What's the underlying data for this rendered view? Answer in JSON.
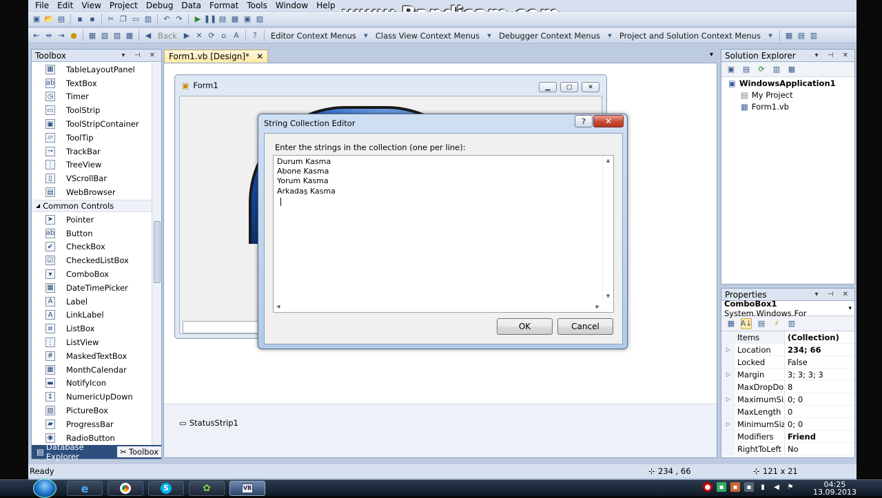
{
  "menubar": {
    "items": [
      "File",
      "Edit",
      "View",
      "Project",
      "Debug",
      "Data",
      "Format",
      "Tools",
      "Window",
      "Help"
    ]
  },
  "watermark": "www.Bandicam.com",
  "toolbar2": {
    "back_label": "Back",
    "menus": [
      "Editor Context Menus",
      "Class View Context Menus",
      "Debugger Context Menus",
      "Project and Solution Context Menus"
    ]
  },
  "toolbox": {
    "title": "Toolbox",
    "items_top": [
      {
        "label": "TableLayoutPanel",
        "icon": "table-layout-icon",
        "glyph": "▦"
      },
      {
        "label": "TextBox",
        "icon": "textbox-icon",
        "glyph": "ab"
      },
      {
        "label": "Timer",
        "icon": "timer-icon",
        "glyph": "◷"
      },
      {
        "label": "ToolStrip",
        "icon": "toolstrip-icon",
        "glyph": "▭"
      },
      {
        "label": "ToolStripContainer",
        "icon": "toolstrip-container-icon",
        "glyph": "▣"
      },
      {
        "label": "ToolTip",
        "icon": "tooltip-icon",
        "glyph": "▱"
      },
      {
        "label": "TrackBar",
        "icon": "trackbar-icon",
        "glyph": "⊸"
      },
      {
        "label": "TreeView",
        "icon": "treeview-icon",
        "glyph": "⋮"
      },
      {
        "label": "VScrollBar",
        "icon": "vscrollbar-icon",
        "glyph": "▯"
      },
      {
        "label": "WebBrowser",
        "icon": "webbrowser-icon",
        "glyph": "▤"
      }
    ],
    "category": "Common Controls",
    "items_common": [
      {
        "label": "Pointer",
        "icon": "pointer-icon",
        "glyph": "➤"
      },
      {
        "label": "Button",
        "icon": "button-icon",
        "glyph": "ab"
      },
      {
        "label": "CheckBox",
        "icon": "checkbox-icon",
        "glyph": "✔"
      },
      {
        "label": "CheckedListBox",
        "icon": "checkedlistbox-icon",
        "glyph": "☑"
      },
      {
        "label": "ComboBox",
        "icon": "combobox-icon",
        "glyph": "▾"
      },
      {
        "label": "DateTimePicker",
        "icon": "datetimepicker-icon",
        "glyph": "▦"
      },
      {
        "label": "Label",
        "icon": "label-icon",
        "glyph": "A"
      },
      {
        "label": "LinkLabel",
        "icon": "linklabel-icon",
        "glyph": "A"
      },
      {
        "label": "ListBox",
        "icon": "listbox-icon",
        "glyph": "≡"
      },
      {
        "label": "ListView",
        "icon": "listview-icon",
        "glyph": "⋮"
      },
      {
        "label": "MaskedTextBox",
        "icon": "maskedtextbox-icon",
        "glyph": "#"
      },
      {
        "label": "MonthCalendar",
        "icon": "monthcalendar-icon",
        "glyph": "▦"
      },
      {
        "label": "NotifyIcon",
        "icon": "notifyicon-icon",
        "glyph": "▬"
      },
      {
        "label": "NumericUpDown",
        "icon": "numericupdown-icon",
        "glyph": "↕"
      },
      {
        "label": "PictureBox",
        "icon": "picturebox-icon",
        "glyph": "▨"
      },
      {
        "label": "ProgressBar",
        "icon": "progressbar-icon",
        "glyph": "▰"
      },
      {
        "label": "RadioButton",
        "icon": "radiobutton-icon",
        "glyph": "◉"
      }
    ],
    "tab_db": "Database Explorer",
    "tab_toolbox": "Toolbox"
  },
  "document": {
    "tab": "Form1.vb [Design]*",
    "form_title": "Form1",
    "tray_component": "StatusStrip1"
  },
  "dialog": {
    "title": "String Collection Editor",
    "help": "?",
    "prompt": "Enter the strings in the collection (one per line):",
    "lines": [
      "Durum Kasma",
      "Abone Kasma",
      "Yorum Kasma",
      "Arkadaş Kasma"
    ],
    "ok": "OK",
    "cancel": "Cancel"
  },
  "solution": {
    "title": "Solution Explorer",
    "project": "WindowsApplication1",
    "my_project": "My Project",
    "file": "Form1.vb"
  },
  "properties": {
    "title": "Properties",
    "object": "ComboBox1",
    "object_type": "System.Windows.For",
    "rows": [
      {
        "name": "Items",
        "value": "(Collection)",
        "bold": true,
        "expand": ""
      },
      {
        "name": "Location",
        "value": "234; 66",
        "bold": true,
        "expand": "▷"
      },
      {
        "name": "Locked",
        "value": "False",
        "bold": false,
        "expand": ""
      },
      {
        "name": "Margin",
        "value": "3; 3; 3; 3",
        "bold": false,
        "expand": "▷"
      },
      {
        "name": "MaxDropDow",
        "value": "8",
        "bold": false,
        "expand": ""
      },
      {
        "name": "MaximumSize",
        "value": "0; 0",
        "bold": false,
        "expand": "▷"
      },
      {
        "name": "MaxLength",
        "value": "0",
        "bold": false,
        "expand": ""
      },
      {
        "name": "MinimumSize",
        "value": "0; 0",
        "bold": false,
        "expand": "▷"
      },
      {
        "name": "Modifiers",
        "value": "Friend",
        "bold": true,
        "expand": ""
      },
      {
        "name": "RightToLeft",
        "value": "No",
        "bold": false,
        "expand": ""
      }
    ]
  },
  "status": {
    "text": "Ready",
    "position": "234 , 66",
    "size": "121 x 21"
  },
  "taskbar": {
    "time": "04:25",
    "date": "13.09.2013"
  }
}
